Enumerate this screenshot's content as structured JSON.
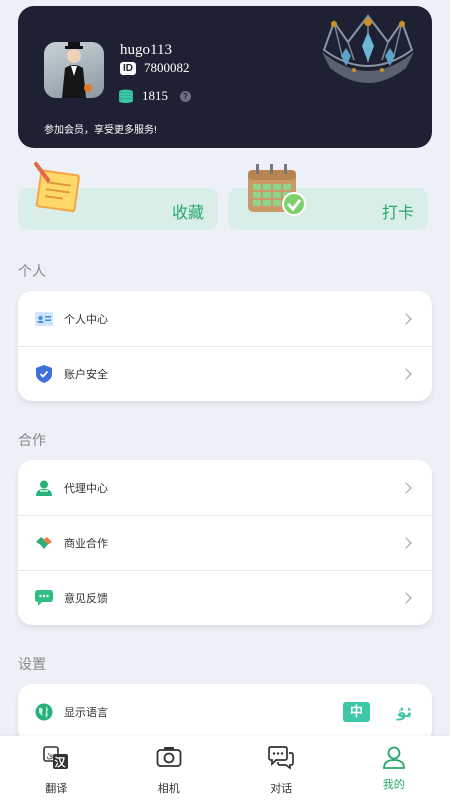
{
  "profile": {
    "username": "hugo113",
    "id_tag": "ID",
    "id_value": "7800082",
    "coins": "1815",
    "help_symbol": "?",
    "member_text": "参加会员，享受更多服务!"
  },
  "quick_actions": {
    "favorites_label": "收藏",
    "checkin_label": "打卡"
  },
  "sections": {
    "personal": {
      "title": "个人",
      "items": [
        {
          "label": "个人中心",
          "icon": "id-card-icon"
        },
        {
          "label": "账户安全",
          "icon": "shield-icon"
        }
      ]
    },
    "cooperation": {
      "title": "合作",
      "items": [
        {
          "label": "代理中心",
          "icon": "agent-icon"
        },
        {
          "label": "商业合作",
          "icon": "handshake-icon"
        },
        {
          "label": "意见反馈",
          "icon": "feedback-chat-icon"
        }
      ]
    },
    "settings": {
      "title": "设置",
      "items": [
        {
          "label": "显示语言",
          "icon": "globe-icon",
          "lang_active": "中",
          "lang_alt": "ئۇ"
        }
      ]
    }
  },
  "tabbar": {
    "tabs": [
      {
        "label": "翻译",
        "icon": "translate-icon"
      },
      {
        "label": "相机",
        "icon": "camera-icon"
      },
      {
        "label": "对话",
        "icon": "chat-icon"
      },
      {
        "label": "我的",
        "icon": "user-icon",
        "active": true
      }
    ]
  },
  "colors": {
    "accent": "#27a86a",
    "teal": "#3cc7a7",
    "card_dark": "#1e2133",
    "page_bg": "#eef0f8"
  }
}
